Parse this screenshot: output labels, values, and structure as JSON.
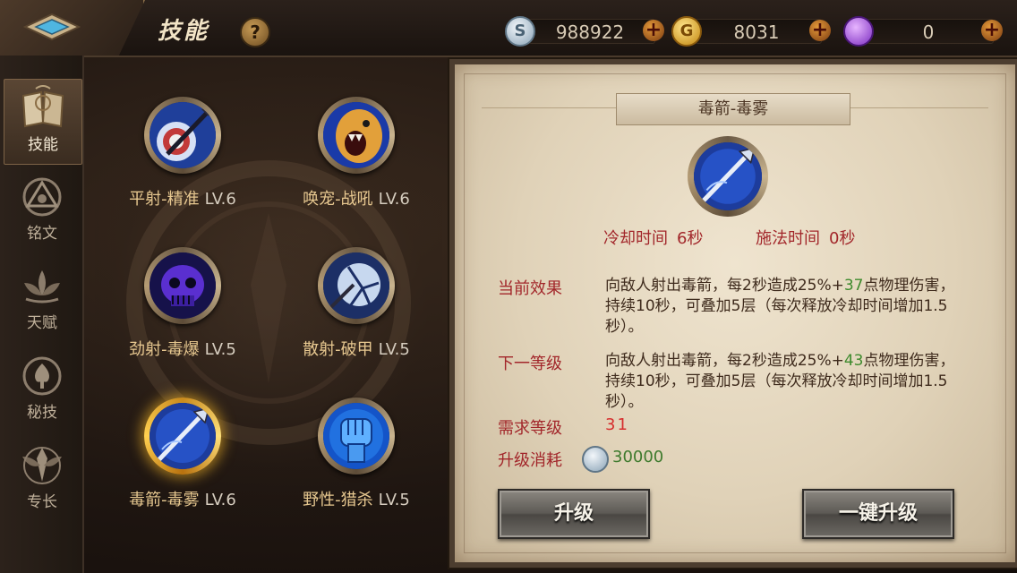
{
  "header": {
    "title": "技能",
    "help_label": "?",
    "currencies": [
      {
        "name": "silver-coin",
        "value": "988922",
        "icon": "S",
        "color": "#9fb7c9"
      },
      {
        "name": "gold-coin",
        "value": "8031",
        "icon": "G",
        "color": "#e0a928"
      },
      {
        "name": "purple-gem",
        "value": "0",
        "icon": "gem",
        "color": "#9b4fd8"
      }
    ],
    "plus_label": "+"
  },
  "sidebar": {
    "items": [
      {
        "label": "技能",
        "active": true,
        "icon": "book-icon"
      },
      {
        "label": "铭文",
        "active": false,
        "icon": "triangle-rune-icon"
      },
      {
        "label": "天赋",
        "active": false,
        "icon": "lotus-icon"
      },
      {
        "label": "秘技",
        "active": false,
        "icon": "spade-crest-icon"
      },
      {
        "label": "专长",
        "active": false,
        "icon": "eagle-crest-icon"
      }
    ]
  },
  "skills": [
    {
      "name": "平射-精准",
      "level": "LV.6",
      "icon": "archer-target-icon",
      "selected": false
    },
    {
      "name": "唤宠-战吼",
      "level": "LV.6",
      "icon": "roaring-beast-icon",
      "selected": false
    },
    {
      "name": "劲射-毒爆",
      "level": "LV.5",
      "icon": "poison-skull-icon",
      "selected": false
    },
    {
      "name": "散射-破甲",
      "level": "LV.5",
      "icon": "shattered-shield-icon",
      "selected": false
    },
    {
      "name": "毒箭-毒雾",
      "level": "LV.6",
      "icon": "poison-arrow-icon",
      "selected": true
    },
    {
      "name": "野性-猎杀",
      "level": "LV.5",
      "icon": "blue-fist-icon",
      "selected": false
    }
  ],
  "detail": {
    "title": "毒箭-毒雾",
    "cooldown_label": "冷却时间",
    "cooldown_value": "6秒",
    "cast_label": "施法时间",
    "cast_value": "0秒",
    "current_effect_label": "当前效果",
    "current_effect_pre": "向敌人射出毒箭，每2秒造成25%+",
    "current_effect_num": "37",
    "current_effect_post": "点物理伤害，持续10秒，可叠加5层（每次释放冷却时间增加1.5秒）。",
    "next_level_label": "下一等级",
    "next_effect_pre": "向敌人射出毒箭，每2秒造成25%+",
    "next_effect_num": "43",
    "next_effect_post": "点物理伤害，持续10秒，可叠加5层（每次释放冷却时间增加1.5秒）。",
    "required_level_label": "需求等级",
    "required_level_value": "31",
    "upgrade_cost_label": "升级消耗",
    "upgrade_cost_value": "30000",
    "upgrade_button": "升级",
    "upgrade_all_button": "一键升级"
  }
}
